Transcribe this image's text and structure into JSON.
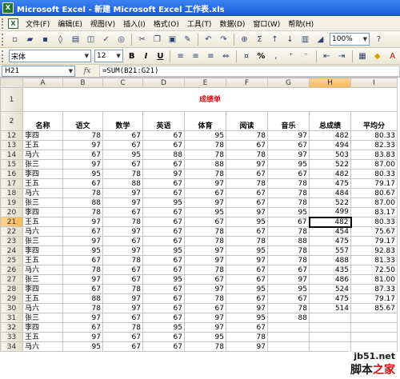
{
  "window": {
    "title": "Microsoft Excel - 新建 Microsoft Excel 工作表.xls"
  },
  "menu": [
    "文件(F)",
    "编辑(E)",
    "视图(V)",
    "插入(I)",
    "格式(O)",
    "工具(T)",
    "数据(D)",
    "窗口(W)",
    "帮助(H)"
  ],
  "toolbar": {
    "zoom": "100%"
  },
  "format_toolbar": {
    "font": "宋体",
    "size": "12",
    "bold": "B",
    "italic": "I",
    "underline": "U",
    "percent": "%"
  },
  "formula_bar": {
    "name_box": "H21",
    "fx": "fx",
    "formula": "=SUM(B21:G21)"
  },
  "columns": [
    "A",
    "B",
    "C",
    "D",
    "E",
    "F",
    "G",
    "H",
    "I"
  ],
  "sheet_title": "成绩单",
  "headers": [
    "名称",
    "语文",
    "数学",
    "英语",
    "体育",
    "阅读",
    "音乐",
    "总成绩",
    "平均分"
  ],
  "rows": [
    {
      "row": "12",
      "cells": [
        "李四",
        "78",
        "67",
        "67",
        "95",
        "78",
        "97",
        "482",
        "80.33"
      ]
    },
    {
      "row": "13",
      "cells": [
        "王五",
        "97",
        "67",
        "67",
        "78",
        "67",
        "67",
        "494",
        "82.33"
      ]
    },
    {
      "row": "14",
      "cells": [
        "马六",
        "67",
        "95",
        "88",
        "78",
        "78",
        "97",
        "503",
        "83.83"
      ]
    },
    {
      "row": "15",
      "cells": [
        "张三",
        "97",
        "67",
        "67",
        "88",
        "97",
        "95",
        "522",
        "87.00"
      ]
    },
    {
      "row": "16",
      "cells": [
        "李四",
        "95",
        "78",
        "97",
        "78",
        "67",
        "67",
        "482",
        "80.33"
      ]
    },
    {
      "row": "17",
      "cells": [
        "王五",
        "67",
        "88",
        "67",
        "97",
        "78",
        "78",
        "475",
        "79.17"
      ]
    },
    {
      "row": "18",
      "cells": [
        "马六",
        "78",
        "97",
        "67",
        "67",
        "67",
        "78",
        "484",
        "80.67"
      ]
    },
    {
      "row": "19",
      "cells": [
        "张三",
        "88",
        "97",
        "95",
        "97",
        "67",
        "78",
        "522",
        "87.00"
      ]
    },
    {
      "row": "20",
      "cells": [
        "李四",
        "78",
        "67",
        "67",
        "95",
        "97",
        "95",
        "499",
        "83.17"
      ]
    },
    {
      "row": "21",
      "cells": [
        "王五",
        "97",
        "78",
        "67",
        "67",
        "95",
        "67",
        "482",
        "80.33"
      ]
    },
    {
      "row": "22",
      "cells": [
        "马六",
        "67",
        "97",
        "67",
        "78",
        "67",
        "78",
        "454",
        "75.67"
      ]
    },
    {
      "row": "23",
      "cells": [
        "张三",
        "97",
        "67",
        "67",
        "78",
        "78",
        "88",
        "475",
        "79.17"
      ]
    },
    {
      "row": "24",
      "cells": [
        "李四",
        "95",
        "97",
        "95",
        "97",
        "95",
        "78",
        "557",
        "92.83"
      ]
    },
    {
      "row": "25",
      "cells": [
        "王五",
        "67",
        "78",
        "67",
        "97",
        "97",
        "78",
        "488",
        "81.33"
      ]
    },
    {
      "row": "26",
      "cells": [
        "马六",
        "78",
        "67",
        "67",
        "78",
        "67",
        "67",
        "435",
        "72.50"
      ]
    },
    {
      "row": "27",
      "cells": [
        "张三",
        "97",
        "67",
        "95",
        "67",
        "67",
        "97",
        "486",
        "81.00"
      ]
    },
    {
      "row": "28",
      "cells": [
        "李四",
        "67",
        "78",
        "67",
        "97",
        "95",
        "95",
        "524",
        "87.33"
      ]
    },
    {
      "row": "29",
      "cells": [
        "王五",
        "88",
        "97",
        "67",
        "78",
        "67",
        "67",
        "475",
        "79.17"
      ]
    },
    {
      "row": "30",
      "cells": [
        "马六",
        "78",
        "97",
        "67",
        "67",
        "97",
        "78",
        "514",
        "85.67"
      ]
    },
    {
      "row": "31",
      "cells": [
        "张三",
        "97",
        "67",
        "67",
        "97",
        "95",
        "88",
        "",
        ""
      ]
    },
    {
      "row": "32",
      "cells": [
        "李四",
        "67",
        "78",
        "95",
        "97",
        "67",
        "",
        "",
        ""
      ]
    },
    {
      "row": "33",
      "cells": [
        "王五",
        "97",
        "67",
        "67",
        "95",
        "78",
        "",
        "",
        ""
      ]
    },
    {
      "row": "34",
      "cells": [
        "马六",
        "95",
        "67",
        "67",
        "78",
        "97",
        "",
        "",
        ""
      ]
    }
  ],
  "watermark": {
    "site": "jb51.net",
    "brand_a": "脚本",
    "brand_b": "之家"
  }
}
